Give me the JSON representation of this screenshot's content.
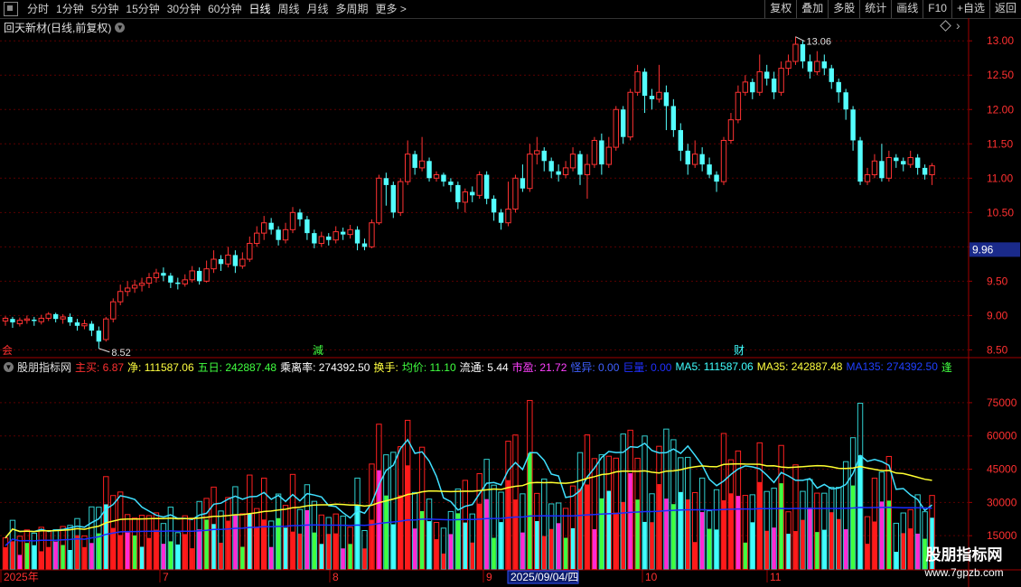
{
  "toolbar": {
    "periods": [
      "分时",
      "1分钟",
      "5分钟",
      "15分钟",
      "30分钟",
      "60分钟",
      "日线",
      "周线",
      "月线",
      "多周期",
      "更多 >"
    ],
    "active_period": "日线",
    "right_buttons": [
      "复权",
      "叠加",
      "多股",
      "统计",
      "画线",
      "F10",
      "+自选",
      "返回"
    ]
  },
  "stock": {
    "title": "回天新材(日线,前复权)"
  },
  "price_axis": {
    "labels": [
      "13.00",
      "12.50",
      "12.00",
      "11.50",
      "11.00",
      "10.50",
      "10.00",
      "9.50",
      "9.00",
      "8.50"
    ],
    "current": "9.96"
  },
  "annotations": {
    "high": "13.06",
    "low": "8.52"
  },
  "event_markers": [
    "会",
    "減",
    "财"
  ],
  "indicator": {
    "name": "股朋指标网",
    "items": [
      {
        "label": "主买: ",
        "value": "6.87",
        "color": "#ff3030"
      },
      {
        "label": "净: ",
        "value": "111587.06",
        "color": "#ffff40"
      },
      {
        "label": "五日: ",
        "value": "242887.48",
        "color": "#40ff40"
      },
      {
        "label": "乘离率: ",
        "value": "274392.50",
        "color": "#ffffff"
      },
      {
        "label": "换手: ",
        "value": "",
        "color": "#ffff40"
      },
      {
        "label": "均价: ",
        "value": "11.10",
        "color": "#40ff40"
      },
      {
        "label": "流通: ",
        "value": "5.44",
        "color": "#ffffff"
      },
      {
        "label": "市盈: ",
        "value": "21.72",
        "color": "#ff40ff"
      },
      {
        "label": "怪异: ",
        "value": "0.00",
        "color": "#4060ff"
      },
      {
        "label": "巨量: ",
        "value": "0.00",
        "color": "#2030ff"
      },
      {
        "label": "MA5: ",
        "value": "111587.06",
        "color": "#40ffff"
      },
      {
        "label": "MA35: ",
        "value": "242887.48",
        "color": "#ffff40"
      },
      {
        "label": "MA135: ",
        "value": "274392.50",
        "color": "#2040ff"
      },
      {
        "label": "",
        "value": "逢",
        "color": "#40ff40"
      }
    ]
  },
  "volume_axis": {
    "labels": [
      "75000",
      "60000",
      "45000",
      "30000",
      "15000"
    ]
  },
  "x_axis": {
    "labels": [
      "2025年",
      "7",
      "8",
      "9",
      "10",
      "11"
    ],
    "cursor_date": "2025/09/04/四"
  },
  "watermark": {
    "line1": "股朋指标网",
    "line2": "www.7gpzb.com"
  },
  "colors": {
    "up": "#ff3232",
    "down": "#54ffff",
    "ma5": "#40e0ff",
    "ma35": "#ffff30",
    "ma135": "#1a2cff"
  },
  "chart_data": {
    "type": "candlestick",
    "x_start_label": "2025年",
    "ylim": [
      8.4,
      13.2
    ],
    "candles": [
      [
        8.92,
        8.96,
        8.85,
        8.99
      ],
      [
        8.95,
        8.9,
        8.82,
        8.98
      ],
      [
        8.88,
        8.93,
        8.84,
        8.97
      ],
      [
        8.93,
        8.95,
        8.88,
        9.0
      ],
      [
        8.94,
        8.92,
        8.85,
        8.98
      ],
      [
        8.91,
        8.96,
        8.87,
        9.01
      ],
      [
        8.96,
        9.02,
        8.92,
        9.05
      ],
      [
        9.02,
        8.95,
        8.9,
        9.04
      ],
      [
        8.95,
        8.98,
        8.88,
        9.02
      ],
      [
        8.98,
        8.9,
        8.85,
        9.03
      ],
      [
        8.9,
        8.85,
        8.78,
        8.95
      ],
      [
        8.85,
        8.88,
        8.8,
        8.94
      ],
      [
        8.88,
        8.78,
        8.7,
        8.92
      ],
      [
        8.78,
        8.62,
        8.52,
        8.84
      ],
      [
        8.65,
        8.95,
        8.62,
        8.98
      ],
      [
        8.95,
        9.2,
        8.9,
        9.25
      ],
      [
        9.2,
        9.35,
        9.15,
        9.45
      ],
      [
        9.35,
        9.4,
        9.28,
        9.5
      ],
      [
        9.4,
        9.44,
        9.33,
        9.52
      ],
      [
        9.44,
        9.47,
        9.35,
        9.55
      ],
      [
        9.47,
        9.55,
        9.4,
        9.62
      ],
      [
        9.55,
        9.62,
        9.48,
        9.68
      ],
      [
        9.62,
        9.58,
        9.5,
        9.7
      ],
      [
        9.58,
        9.48,
        9.4,
        9.62
      ],
      [
        9.48,
        9.46,
        9.38,
        9.55
      ],
      [
        9.46,
        9.52,
        9.42,
        9.6
      ],
      [
        9.52,
        9.65,
        9.48,
        9.72
      ],
      [
        9.65,
        9.5,
        9.45,
        9.7
      ],
      [
        9.5,
        9.68,
        9.48,
        9.8
      ],
      [
        9.68,
        9.82,
        9.62,
        9.95
      ],
      [
        9.82,
        9.75,
        9.65,
        9.88
      ],
      [
        9.75,
        9.88,
        9.7,
        10.0
      ],
      [
        9.88,
        9.72,
        9.62,
        9.95
      ],
      [
        9.72,
        9.82,
        9.68,
        9.92
      ],
      [
        9.82,
        10.05,
        9.78,
        10.15
      ],
      [
        10.05,
        10.2,
        10.0,
        10.3
      ],
      [
        10.2,
        10.35,
        10.1,
        10.45
      ],
      [
        10.35,
        10.25,
        10.18,
        10.42
      ],
      [
        10.25,
        10.1,
        10.02,
        10.3
      ],
      [
        10.1,
        10.25,
        10.05,
        10.35
      ],
      [
        10.25,
        10.5,
        10.2,
        10.58
      ],
      [
        10.5,
        10.4,
        10.3,
        10.55
      ],
      [
        10.4,
        10.2,
        10.1,
        10.45
      ],
      [
        10.2,
        10.05,
        9.98,
        10.25
      ],
      [
        10.05,
        10.15,
        10.0,
        10.22
      ],
      [
        10.15,
        10.1,
        10.02,
        10.2
      ],
      [
        10.1,
        10.22,
        10.05,
        10.3
      ],
      [
        10.22,
        10.18,
        10.1,
        10.28
      ],
      [
        10.18,
        10.25,
        10.12,
        10.32
      ],
      [
        10.25,
        10.05,
        9.95,
        10.3
      ],
      [
        10.05,
        10.0,
        9.95,
        10.12
      ],
      [
        10.0,
        10.35,
        9.98,
        10.4
      ],
      [
        10.35,
        11.0,
        10.32,
        11.05
      ],
      [
        11.0,
        10.9,
        10.6,
        11.08
      ],
      [
        10.9,
        10.5,
        10.42,
        10.95
      ],
      [
        10.5,
        10.95,
        10.45,
        11.0
      ],
      [
        10.95,
        11.35,
        10.9,
        11.55
      ],
      [
        11.35,
        11.15,
        11.05,
        11.4
      ],
      [
        11.15,
        11.25,
        11.1,
        11.6
      ],
      [
        11.25,
        11.0,
        10.95,
        11.3
      ],
      [
        11.0,
        11.05,
        10.95,
        11.1
      ],
      [
        11.05,
        10.95,
        10.88,
        11.08
      ],
      [
        10.95,
        10.9,
        10.8,
        11.0
      ],
      [
        10.9,
        10.65,
        10.55,
        10.95
      ],
      [
        10.65,
        10.8,
        10.5,
        10.85
      ],
      [
        10.8,
        10.75,
        10.65,
        10.88
      ],
      [
        10.75,
        11.05,
        10.7,
        11.1
      ],
      [
        11.05,
        10.7,
        10.62,
        11.1
      ],
      [
        10.7,
        10.5,
        10.38,
        10.75
      ],
      [
        10.5,
        10.35,
        10.25,
        10.55
      ],
      [
        10.35,
        10.55,
        10.3,
        10.95
      ],
      [
        10.55,
        11.0,
        10.5,
        11.05
      ],
      [
        11.0,
        10.85,
        10.8,
        11.2
      ],
      [
        10.85,
        11.35,
        10.8,
        11.5
      ],
      [
        11.35,
        11.4,
        11.2,
        11.6
      ],
      [
        11.4,
        11.25,
        11.1,
        11.45
      ],
      [
        11.25,
        11.1,
        11.0,
        11.3
      ],
      [
        11.1,
        11.05,
        10.95,
        11.2
      ],
      [
        11.05,
        11.15,
        11.0,
        11.25
      ],
      [
        11.15,
        11.35,
        11.1,
        11.45
      ],
      [
        11.35,
        11.05,
        10.9,
        11.4
      ],
      [
        11.05,
        11.2,
        10.7,
        11.35
      ],
      [
        11.2,
        11.55,
        11.15,
        11.6
      ],
      [
        11.55,
        11.2,
        11.05,
        11.65
      ],
      [
        11.2,
        11.45,
        11.15,
        11.6
      ],
      [
        11.45,
        12.0,
        11.4,
        12.05
      ],
      [
        12.0,
        11.6,
        11.5,
        12.05
      ],
      [
        11.6,
        12.25,
        11.55,
        12.3
      ],
      [
        12.25,
        12.55,
        12.2,
        12.65
      ],
      [
        12.55,
        12.2,
        11.95,
        12.6
      ],
      [
        12.2,
        12.15,
        12.0,
        12.3
      ],
      [
        12.15,
        12.25,
        12.1,
        12.65
      ],
      [
        12.25,
        12.05,
        11.7,
        12.35
      ],
      [
        12.05,
        11.7,
        11.6,
        12.15
      ],
      [
        11.7,
        11.4,
        11.25,
        11.8
      ],
      [
        11.4,
        11.2,
        11.05,
        11.5
      ],
      [
        11.2,
        11.35,
        11.15,
        11.55
      ],
      [
        11.35,
        11.2,
        11.1,
        11.45
      ],
      [
        11.2,
        11.05,
        11.0,
        11.3
      ],
      [
        11.05,
        10.95,
        10.8,
        11.1
      ],
      [
        10.95,
        11.55,
        10.9,
        11.6
      ],
      [
        11.55,
        11.85,
        11.5,
        11.95
      ],
      [
        11.85,
        12.25,
        11.8,
        12.35
      ],
      [
        12.25,
        12.4,
        12.2,
        12.5
      ],
      [
        12.4,
        12.25,
        12.15,
        12.45
      ],
      [
        12.25,
        12.55,
        12.2,
        12.8
      ],
      [
        12.55,
        12.45,
        12.35,
        12.65
      ],
      [
        12.45,
        12.25,
        12.15,
        12.55
      ],
      [
        12.25,
        12.6,
        12.2,
        12.7
      ],
      [
        12.6,
        12.7,
        12.5,
        12.8
      ],
      [
        12.7,
        12.95,
        12.65,
        13.06
      ],
      [
        12.95,
        12.7,
        12.6,
        13.0
      ],
      [
        12.7,
        12.55,
        12.45,
        12.8
      ],
      [
        12.55,
        12.7,
        12.5,
        12.85
      ],
      [
        12.7,
        12.6,
        12.5,
        12.8
      ],
      [
        12.6,
        12.4,
        12.3,
        12.65
      ],
      [
        12.4,
        12.25,
        12.1,
        12.45
      ],
      [
        12.25,
        12.0,
        11.85,
        12.3
      ],
      [
        12.0,
        11.55,
        11.4,
        12.05
      ],
      [
        11.55,
        10.95,
        10.9,
        11.6
      ],
      [
        10.95,
        11.05,
        10.9,
        11.15
      ],
      [
        11.05,
        11.25,
        11.0,
        11.35
      ],
      [
        11.25,
        11.0,
        10.95,
        11.5
      ],
      [
        11.0,
        11.3,
        10.95,
        11.4
      ],
      [
        11.3,
        11.25,
        11.15,
        11.35
      ],
      [
        11.25,
        11.2,
        11.1,
        11.3
      ],
      [
        11.2,
        11.3,
        11.15,
        11.4
      ],
      [
        11.3,
        11.15,
        11.05,
        11.35
      ],
      [
        11.15,
        11.05,
        10.98,
        11.2
      ],
      [
        11.05,
        11.18,
        10.9,
        11.22
      ]
    ]
  }
}
